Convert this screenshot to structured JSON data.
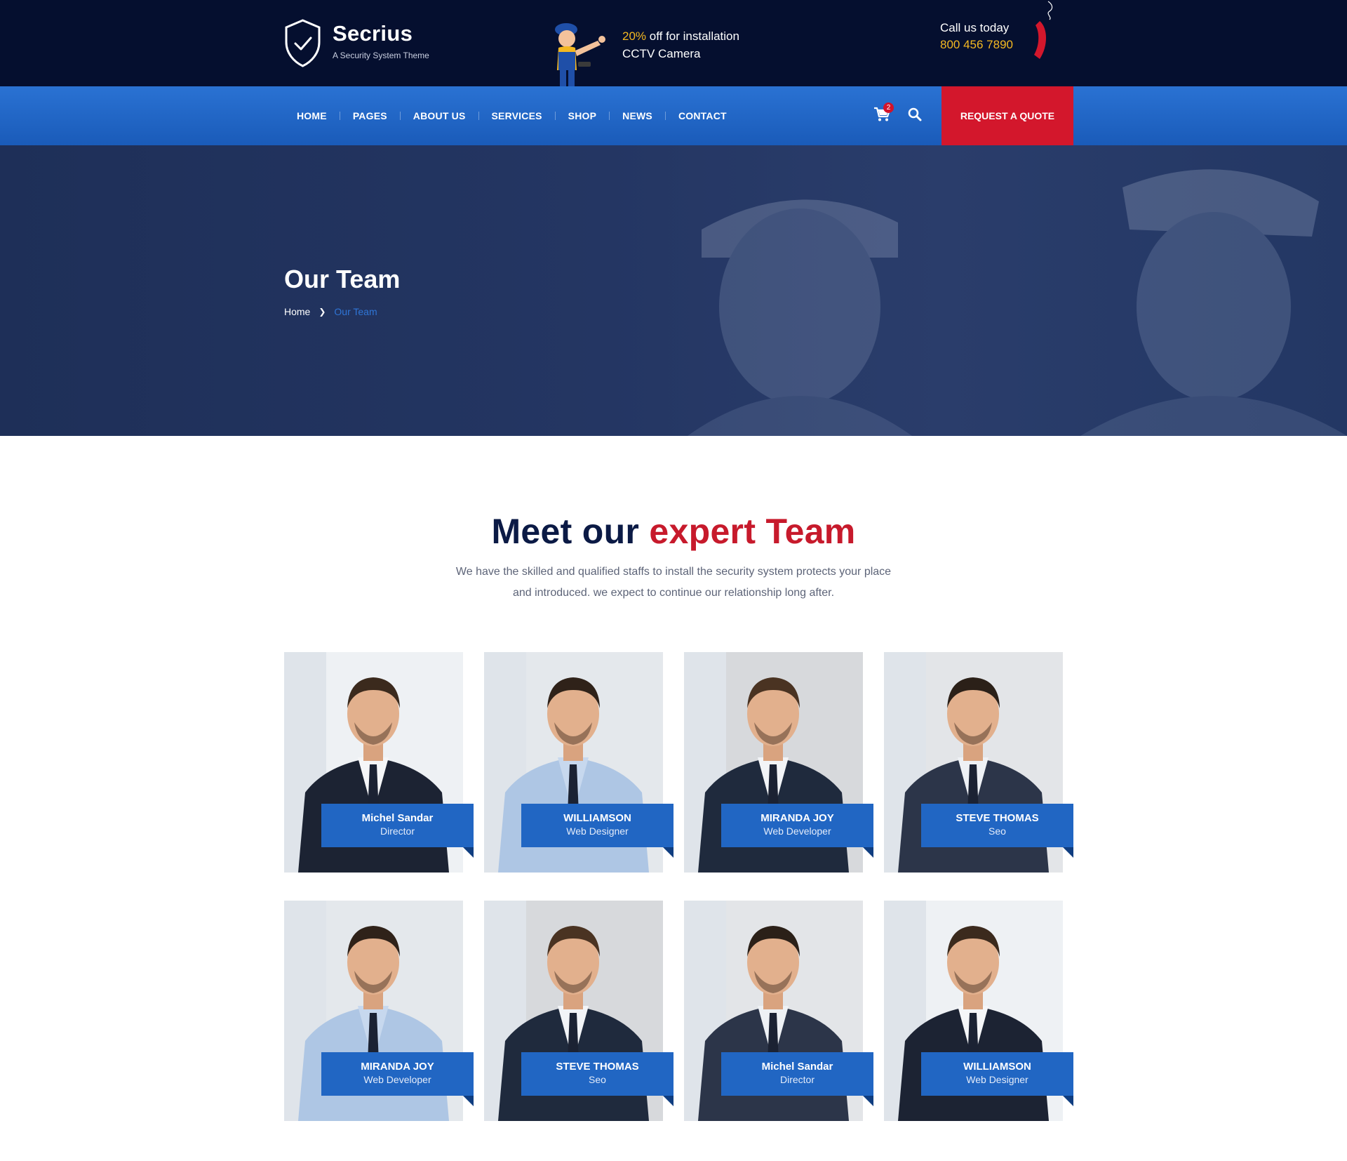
{
  "brand": {
    "name": "Secrius",
    "tagline": "A Security System Theme"
  },
  "promo": {
    "highlight": "20%",
    "line1_rest": " off for installation",
    "line2": "CCTV Camera"
  },
  "contact": {
    "label": "Call us today",
    "phone": "800 456 7890"
  },
  "nav": {
    "items": [
      {
        "label": "HOME"
      },
      {
        "label": "PAGES"
      },
      {
        "label": "ABOUT US"
      },
      {
        "label": "SERVICES"
      },
      {
        "label": "SHOP"
      },
      {
        "label": "NEWS"
      },
      {
        "label": "CONTACT"
      }
    ],
    "cart_count": "2",
    "quote_button": "REQUEST A QUOTE"
  },
  "hero": {
    "title": "Our Team",
    "breadcrumb_home": "Home",
    "breadcrumb_current": "Our Team"
  },
  "section": {
    "title_part1": "Meet our ",
    "title_part2": "expert Team",
    "description_line1": "We have the skilled and qualified staffs to install the security system protects your place",
    "description_line2": "and introduced. we expect to continue our relationship long after."
  },
  "team": [
    {
      "name": "Michel Sandar",
      "role": "Director"
    },
    {
      "name": "WILLIAMSON",
      "role": "Web Designer"
    },
    {
      "name": "MIRANDA JOY",
      "role": "Web Developer"
    },
    {
      "name": "STEVE THOMAS",
      "role": "Seo"
    },
    {
      "name": "MIRANDA JOY",
      "role": "Web Developer"
    },
    {
      "name": "STEVE THOMAS",
      "role": "Seo"
    },
    {
      "name": "Michel Sandar",
      "role": "Director"
    },
    {
      "name": "WILLIAMSON",
      "role": "Web Designer"
    }
  ],
  "colors": {
    "header_bg": "#050f2f",
    "nav_blue": "#1a5bb9",
    "accent_red": "#d3172c",
    "accent_yellow": "#f4b821",
    "tag_blue": "#2166c3"
  }
}
